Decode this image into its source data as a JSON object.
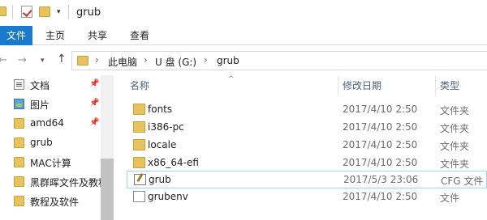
{
  "window": {
    "title": "grub",
    "qa_dropdown": "▾"
  },
  "ribbon": {
    "tabs": [
      {
        "label": "文件"
      },
      {
        "label": "主页"
      },
      {
        "label": "共享"
      },
      {
        "label": "查看"
      }
    ]
  },
  "navigation": {
    "back": "←",
    "forward": "→",
    "recent": "▾",
    "up": "↑"
  },
  "address": {
    "segments": [
      "此电脑",
      "U 盘 (G:)",
      "grub"
    ],
    "separator": "›"
  },
  "sidebar": {
    "pin_glyph": "📌",
    "items": [
      {
        "label": "文档",
        "icon": "document-icon",
        "pinned": true
      },
      {
        "label": "图片",
        "icon": "picture-icon",
        "pinned": true
      },
      {
        "label": "amd64",
        "icon": "folder-icon",
        "pinned": true
      },
      {
        "label": "grub",
        "icon": "folder-icon",
        "pinned": false
      },
      {
        "label": "MAC计算",
        "icon": "folder-icon",
        "pinned": false
      },
      {
        "label": "黑群晖文件及教程",
        "icon": "folder-icon",
        "pinned": false
      },
      {
        "label": "教程及软件",
        "icon": "folder-icon",
        "pinned": false
      }
    ]
  },
  "filelist": {
    "sort_indicator": "^",
    "columns": {
      "name": "名称",
      "date": "修改日期",
      "type": "类型"
    },
    "rows": [
      {
        "name": "fonts",
        "date": "2017/4/10 2:50",
        "type": "文件夹",
        "icon": "folder-icon"
      },
      {
        "name": "i386-pc",
        "date": "2017/4/10 2:50",
        "type": "文件夹",
        "icon": "folder-icon"
      },
      {
        "name": "locale",
        "date": "2017/4/10 2:50",
        "type": "文件夹",
        "icon": "folder-icon"
      },
      {
        "name": "x86_64-efi",
        "date": "2017/4/10 2:50",
        "type": "文件夹",
        "icon": "folder-icon"
      },
      {
        "name": "grub",
        "date": "2017/5/3 23:06",
        "type": "CFG 文件",
        "icon": "cfg-file-icon",
        "selected": true
      },
      {
        "name": "grubenv",
        "date": "2017/4/10 2:50",
        "type": "文件",
        "icon": "file-icon"
      }
    ]
  }
}
